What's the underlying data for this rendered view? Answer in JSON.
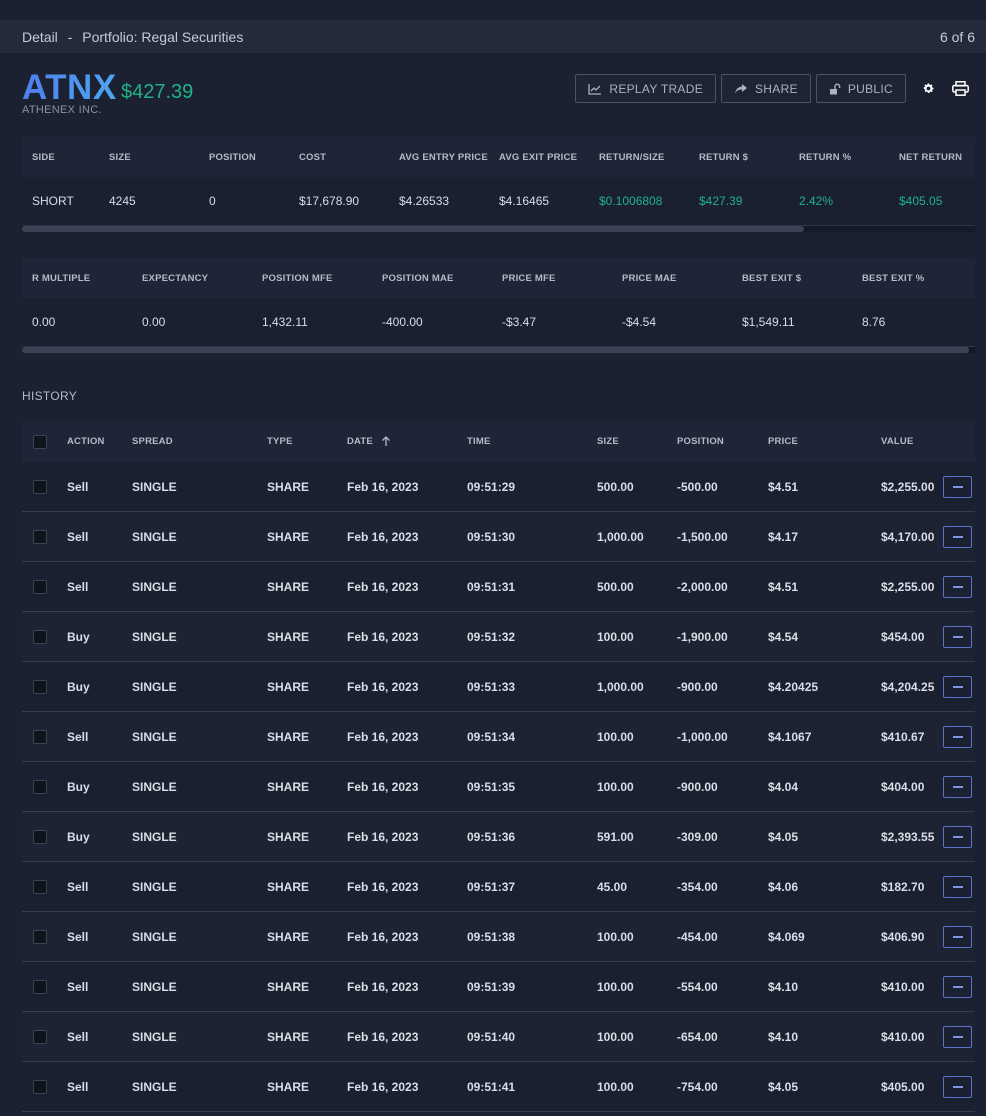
{
  "header": {
    "title": "Detail",
    "separator": "-",
    "portfolio": "Portfolio: Regal Securities",
    "pager": "6 of 6"
  },
  "ticker": {
    "symbol": "ATNX",
    "price": "$427.39",
    "company": "ATHENEX INC."
  },
  "toolbar": {
    "replay_label": "REPLAY TRADE",
    "share_label": "SHARE",
    "public_label": "PUBLIC"
  },
  "summary": {
    "columns": [
      "SIDE",
      "SIZE",
      "POSITION",
      "COST",
      "AVG ENTRY PRICE",
      "AVG EXIT PRICE",
      "RETURN/SIZE",
      "RETURN $",
      "RETURN %",
      "NET RETURN"
    ],
    "row": [
      "SHORT",
      "4245",
      "0",
      "$17,678.90",
      "$4.26533",
      "$4.16465",
      "$0.1006808",
      "$427.39",
      "2.42%",
      "$405.05"
    ]
  },
  "metrics": {
    "columns": [
      "R MULTIPLE",
      "EXPECTANCY",
      "POSITION MFE",
      "POSITION MAE",
      "PRICE MFE",
      "PRICE MAE",
      "BEST EXIT $",
      "BEST EXIT %"
    ],
    "row": [
      "0.00",
      "0.00",
      "1,432.11",
      "-400.00",
      "-$3.47",
      "-$4.54",
      "$1,549.11",
      "8.76"
    ]
  },
  "history": {
    "label": "HISTORY",
    "columns": [
      "ACTION",
      "SPREAD",
      "TYPE",
      "DATE",
      "TIME",
      "SIZE",
      "POSITION",
      "PRICE",
      "VALUE"
    ],
    "rows": [
      [
        "Sell",
        "SINGLE",
        "SHARE",
        "Feb 16, 2023",
        "09:51:29",
        "500.00",
        "-500.00",
        "$4.51",
        "$2,255.00"
      ],
      [
        "Sell",
        "SINGLE",
        "SHARE",
        "Feb 16, 2023",
        "09:51:30",
        "1,000.00",
        "-1,500.00",
        "$4.17",
        "$4,170.00"
      ],
      [
        "Sell",
        "SINGLE",
        "SHARE",
        "Feb 16, 2023",
        "09:51:31",
        "500.00",
        "-2,000.00",
        "$4.51",
        "$2,255.00"
      ],
      [
        "Buy",
        "SINGLE",
        "SHARE",
        "Feb 16, 2023",
        "09:51:32",
        "100.00",
        "-1,900.00",
        "$4.54",
        "$454.00"
      ],
      [
        "Buy",
        "SINGLE",
        "SHARE",
        "Feb 16, 2023",
        "09:51:33",
        "1,000.00",
        "-900.00",
        "$4.20425",
        "$4,204.25"
      ],
      [
        "Sell",
        "SINGLE",
        "SHARE",
        "Feb 16, 2023",
        "09:51:34",
        "100.00",
        "-1,000.00",
        "$4.1067",
        "$410.67"
      ],
      [
        "Buy",
        "SINGLE",
        "SHARE",
        "Feb 16, 2023",
        "09:51:35",
        "100.00",
        "-900.00",
        "$4.04",
        "$404.00"
      ],
      [
        "Buy",
        "SINGLE",
        "SHARE",
        "Feb 16, 2023",
        "09:51:36",
        "591.00",
        "-309.00",
        "$4.05",
        "$2,393.55"
      ],
      [
        "Sell",
        "SINGLE",
        "SHARE",
        "Feb 16, 2023",
        "09:51:37",
        "45.00",
        "-354.00",
        "$4.06",
        "$182.70"
      ],
      [
        "Sell",
        "SINGLE",
        "SHARE",
        "Feb 16, 2023",
        "09:51:38",
        "100.00",
        "-454.00",
        "$4.069",
        "$406.90"
      ],
      [
        "Sell",
        "SINGLE",
        "SHARE",
        "Feb 16, 2023",
        "09:51:39",
        "100.00",
        "-554.00",
        "$4.10",
        "$410.00"
      ],
      [
        "Sell",
        "SINGLE",
        "SHARE",
        "Feb 16, 2023",
        "09:51:40",
        "100.00",
        "-654.00",
        "$4.10",
        "$410.00"
      ],
      [
        "Sell",
        "SINGLE",
        "SHARE",
        "Feb 16, 2023",
        "09:51:41",
        "100.00",
        "-754.00",
        "$4.05",
        "$405.00"
      ]
    ]
  },
  "colors": {
    "accent": "#4f7ef0",
    "positive": "#1fb289",
    "background": "#1b2130"
  }
}
